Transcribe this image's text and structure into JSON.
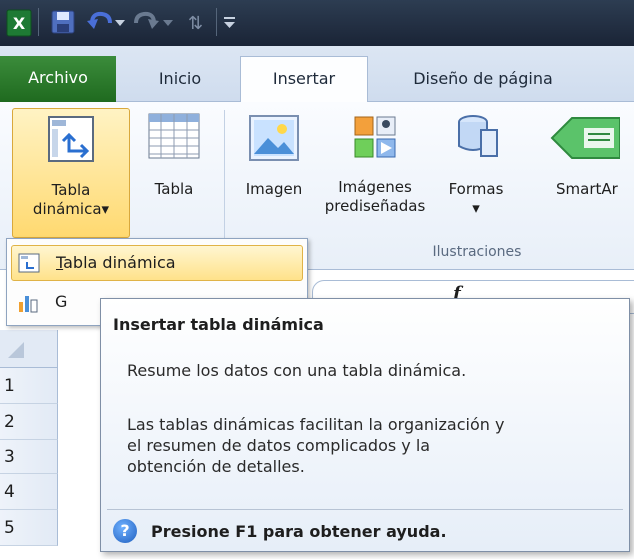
{
  "tabs": {
    "file": "Archivo",
    "items": [
      "Inicio",
      "Insertar",
      "Diseño de página"
    ]
  },
  "ribbon": {
    "pivot_button": [
      "Tabla",
      "dinámica"
    ],
    "pivot_arrow": "▾",
    "table_button": "Tabla",
    "image_button": "Imagen",
    "clipart_button": [
      "Imágenes",
      "prediseñadas"
    ],
    "shapes_button": "Formas",
    "shapes_arrow": "▾",
    "smartart_button": "SmartAr",
    "group_illustrations": "Ilustraciones"
  },
  "dropdown": {
    "item1": "Tabla dinámica",
    "item1_accel": "T",
    "item1_rest": "abla dinámica",
    "item2_prefix": "G"
  },
  "formula_bar": {
    "fx": "f"
  },
  "rows": [
    "1",
    "2",
    "3",
    "4",
    "5"
  ],
  "tooltip": {
    "title": "Insertar tabla dinámica",
    "line1": "Resume los datos con una tabla dinámica.",
    "para": [
      "Las tablas dinámicas facilitan la organización y",
      "el resumen de datos complicados y la",
      "obtención de detalles."
    ],
    "help": "Presione F1 para obtener ayuda."
  },
  "colors": {
    "file_tab": "#2a7a2a",
    "highlight": "#ffe28a",
    "title_bar": "#1f2a3c"
  }
}
